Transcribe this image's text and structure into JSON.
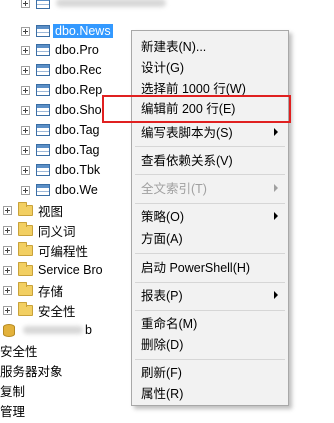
{
  "tree": {
    "tables": [
      {
        "label": "dbo.News",
        "selected": true
      },
      {
        "label": "dbo.Pro",
        "selected": false
      },
      {
        "label": "dbo.Rec",
        "selected": false
      },
      {
        "label": "dbo.Rep",
        "selected": false
      },
      {
        "label": "dbo.Sho",
        "selected": false
      },
      {
        "label": "dbo.Tag",
        "selected": false
      },
      {
        "label": "dbo.Tag",
        "selected": false
      },
      {
        "label": "dbo.Tbk",
        "selected": false
      },
      {
        "label": "dbo.We",
        "selected": false
      }
    ],
    "folders": [
      {
        "label": "视图"
      },
      {
        "label": "同义词"
      },
      {
        "label": "可编程性"
      },
      {
        "label": "Service Bro"
      },
      {
        "label": "存储"
      },
      {
        "label": "安全性"
      }
    ],
    "database_suffix": "b",
    "root_items": [
      {
        "label": "安全性"
      },
      {
        "label": "服务器对象"
      },
      {
        "label": "复制"
      },
      {
        "label": "管理"
      }
    ]
  },
  "context_menu": {
    "items": [
      {
        "label": "新建表(N)...",
        "enabled": true,
        "submenu": false
      },
      {
        "label": "设计(G)",
        "enabled": true,
        "submenu": false
      },
      {
        "label": "选择前 1000 行(W)",
        "enabled": true,
        "submenu": false
      },
      {
        "label": "编辑前 200 行(E)",
        "enabled": true,
        "submenu": false
      },
      {
        "label": "编写表脚本为(S)",
        "enabled": true,
        "submenu": true
      },
      {
        "label": "查看依赖关系(V)",
        "enabled": true,
        "submenu": false
      },
      {
        "label": "全文索引(T)",
        "enabled": false,
        "submenu": true
      },
      {
        "label": "策略(O)",
        "enabled": true,
        "submenu": true
      },
      {
        "label": "方面(A)",
        "enabled": true,
        "submenu": false
      },
      {
        "label": "启动 PowerShell(H)",
        "enabled": true,
        "submenu": false
      },
      {
        "label": "报表(P)",
        "enabled": true,
        "submenu": true
      },
      {
        "label": "重命名(M)",
        "enabled": true,
        "submenu": false
      },
      {
        "label": "删除(D)",
        "enabled": true,
        "submenu": false
      },
      {
        "label": "刷新(F)",
        "enabled": true,
        "submenu": false
      },
      {
        "label": "属性(R)",
        "enabled": true,
        "submenu": false
      }
    ],
    "highlighted_item": "编辑前 200 行(E)",
    "highlight_color": "#e02020"
  },
  "colors": {
    "selection": "#3399ff",
    "menu_background": "#f2f2f2"
  }
}
